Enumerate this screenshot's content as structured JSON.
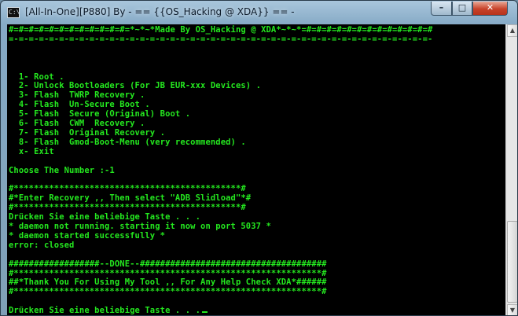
{
  "window": {
    "title": "[All-In-One][P880] By - == {{OS_Hacking @ XDA}} == -",
    "icon": "cmd-console-icon",
    "buttons": {
      "minimize": "–",
      "maximize": "□",
      "close": "✕"
    }
  },
  "console": {
    "text_color": "#24e81f",
    "background": "#000000",
    "lines": [
      "#=#=#=#=#=#=#=#=#=#=#=#=*~*~*Made By OS_Hacking @ XDA*~*~*=#=#=#=#=#=#=#=#=#=#=#=#=#",
      "=-=-=-=-=-=-=-=-=-=-=-=-=-=-=-=-=-=-=-=-=-=-=-=-=-=-=-=-=-=-=-=-=-=-=-=-=-=-=-=-=-=-",
      "",
      "",
      "",
      "  1- Root .",
      "  2- Unlock Bootloaders (For JB EUR-xxx Devices) .",
      "  3- Flash  TWRP Recovery .",
      "  4- Flash  Un-Secure Boot .",
      "  5- Flash  Secure (Original) Boot .",
      "  6- Flash  CWM  Recovery .",
      "  7- Flash  Original Recovery .",
      "  8- Flash  Gmod-Boot-Menu (very recommended) .",
      "  x- Exit",
      "",
      "Choose The Number :-1",
      "",
      "#*********************************************#",
      "#*Enter Recovery ,, Then select \"ADB Slidload\"*#",
      "#*********************************************#",
      "Drücken Sie eine beliebige Taste . . .",
      "* daemon not running. starting it now on port 5037 *",
      "* daemon started successfully *",
      "error: closed",
      "",
      "##################--DONE--#####################################",
      "#*************************************************************#",
      "##*Thank You For Using My Tool ,, For Any Help Check XDA*######",
      "#*************************************************************#",
      "",
      "Drücken Sie eine beliebige Taste . . ."
    ]
  },
  "scrollbar": {
    "up_icon": "▲",
    "down_icon": "▼"
  }
}
